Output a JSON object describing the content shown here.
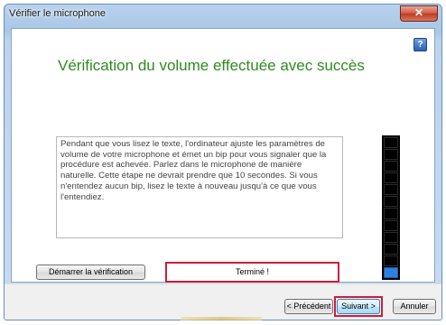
{
  "window": {
    "title": "Vérifier le microphone",
    "close_glyph": "✕",
    "help_glyph": "?"
  },
  "main": {
    "heading": "Vérification du volume effectuée avec succès",
    "instructions": "Pendant que vous lisez le texte, l'ordinateur ajuste les paramètres de volume de votre microphone et émet un bip pour vous signaler que la procédure est achevée. Parlez dans le microphone de manière naturelle. Cette étape ne devrait prendre que 10 secondes. Si vous n'entendez aucun bip, lisez le texte à nouveau jusqu'à ce que vous l'entendiez.",
    "start_button": "Démarrer la vérification",
    "status": "Terminé !",
    "volume_meter": {
      "segments": 12,
      "lit_segments": 1,
      "lit_color": "#2f7fe0"
    }
  },
  "footer": {
    "prev_button": "< Précédent",
    "next_button": "Suivant >",
    "cancel_button": "Annuler"
  },
  "colors": {
    "heading": "#2e8b1f",
    "highlight": "#c8203a"
  },
  "icons": {
    "close": "close-icon",
    "help": "help-icon"
  }
}
